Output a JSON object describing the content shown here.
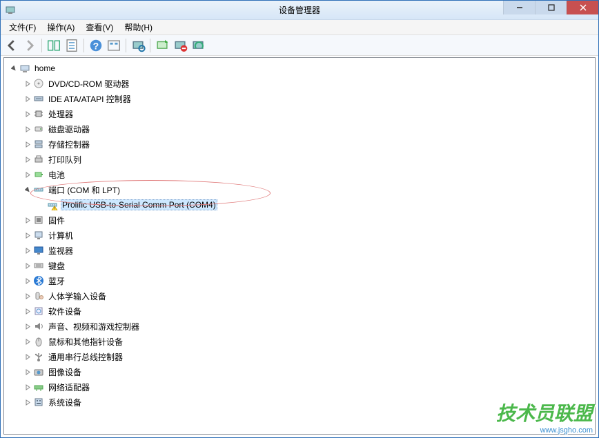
{
  "window": {
    "title": "设备管理器"
  },
  "menu": {
    "file": "文件(F)",
    "action": "操作(A)",
    "view": "查看(V)",
    "help": "帮助(H)"
  },
  "tree": {
    "root": {
      "label": "home",
      "expanded": true
    },
    "categories": [
      {
        "label": "DVD/CD-ROM 驱动器",
        "icon": "disc"
      },
      {
        "label": "IDE ATA/ATAPI 控制器",
        "icon": "ide"
      },
      {
        "label": "处理器",
        "icon": "cpu"
      },
      {
        "label": "磁盘驱动器",
        "icon": "disk"
      },
      {
        "label": "存储控制器",
        "icon": "storage"
      },
      {
        "label": "打印队列",
        "icon": "printer"
      },
      {
        "label": "电池",
        "icon": "battery"
      },
      {
        "label": "端口 (COM 和 LPT)",
        "icon": "port",
        "expanded": true,
        "highlighted": true,
        "children": [
          {
            "label": "Prolific USB-to-Serial Comm Port (COM4)",
            "icon": "port-warn",
            "selected": true
          }
        ]
      },
      {
        "label": "固件",
        "icon": "firmware"
      },
      {
        "label": "计算机",
        "icon": "computer"
      },
      {
        "label": "监视器",
        "icon": "monitor"
      },
      {
        "label": "键盘",
        "icon": "keyboard"
      },
      {
        "label": "蓝牙",
        "icon": "bluetooth"
      },
      {
        "label": "人体学输入设备",
        "icon": "hid"
      },
      {
        "label": "软件设备",
        "icon": "software"
      },
      {
        "label": "声音、视频和游戏控制器",
        "icon": "sound"
      },
      {
        "label": "鼠标和其他指针设备",
        "icon": "mouse"
      },
      {
        "label": "通用串行总线控制器",
        "icon": "usb"
      },
      {
        "label": "图像设备",
        "icon": "imaging"
      },
      {
        "label": "网络适配器",
        "icon": "network"
      },
      {
        "label": "系统设备",
        "icon": "system"
      }
    ]
  },
  "watermark": {
    "main": "技术员联盟",
    "sub": "www.jsgho.com"
  }
}
